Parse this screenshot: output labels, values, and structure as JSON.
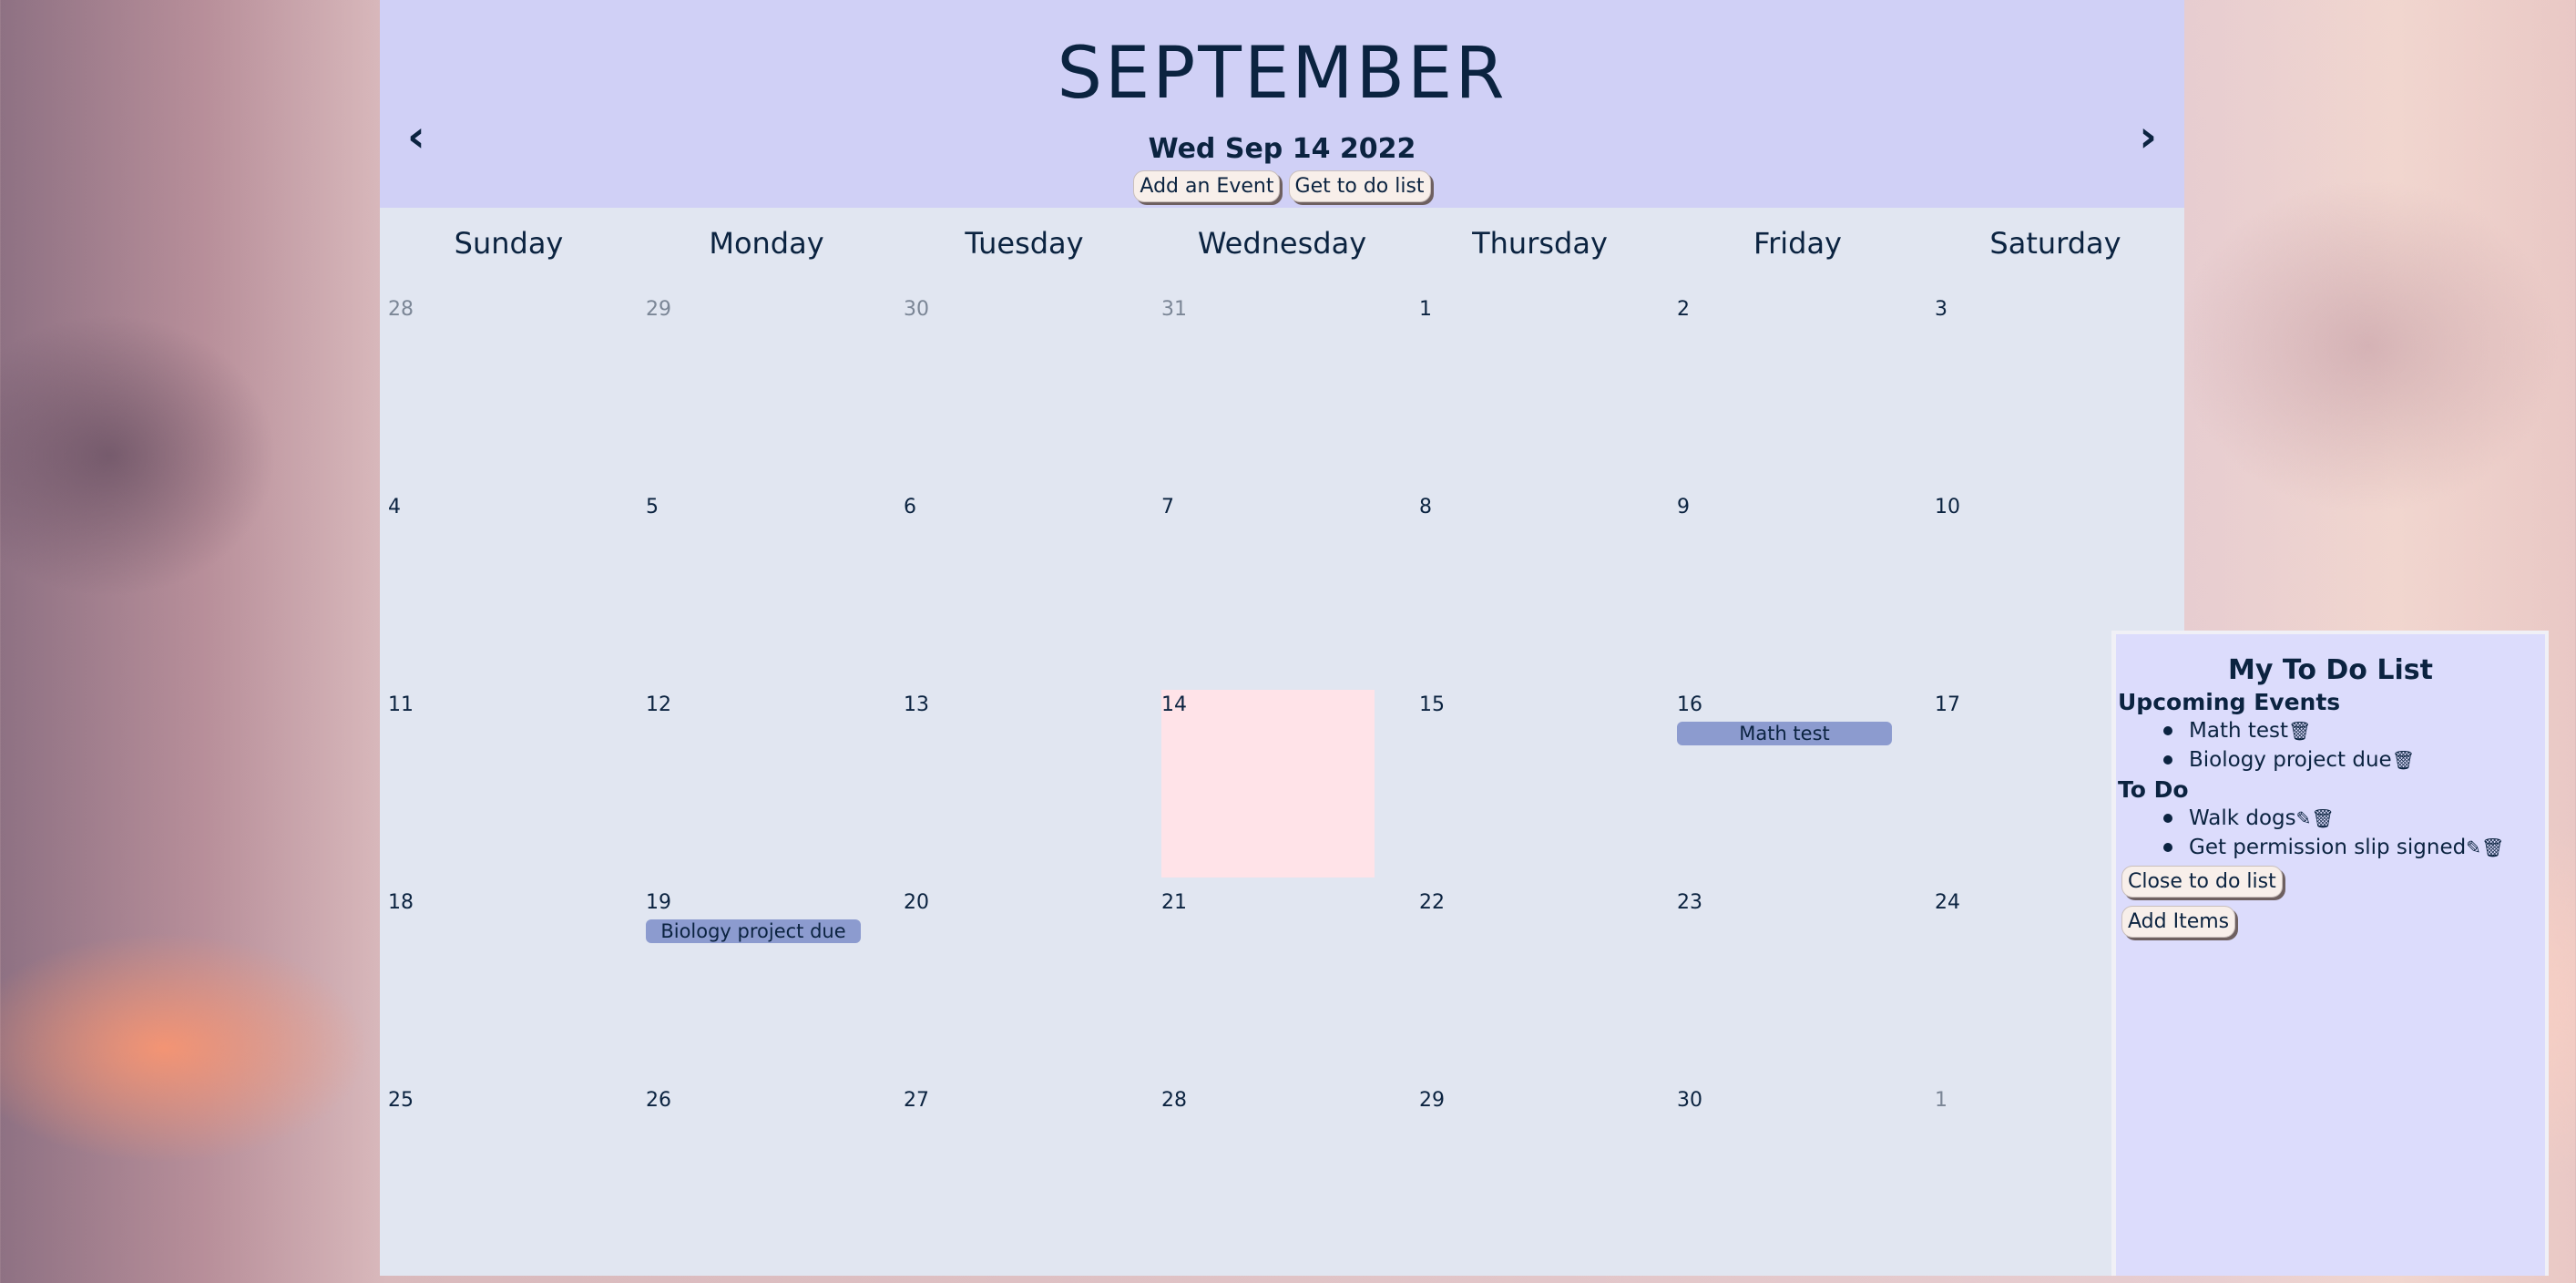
{
  "header": {
    "month": "SEPTEMBER",
    "date": "Wed Sep 14 2022",
    "prev_icon": "chevron-left-icon",
    "next_icon": "chevron-right-icon",
    "add_event_label": "Add an Event",
    "todo_label": "Get to do list"
  },
  "weekdays": [
    "Sunday",
    "Monday",
    "Tuesday",
    "Wednesday",
    "Thursday",
    "Friday",
    "Saturday"
  ],
  "weeks": [
    [
      {
        "d": "28",
        "other": true
      },
      {
        "d": "29",
        "other": true
      },
      {
        "d": "30",
        "other": true
      },
      {
        "d": "31",
        "other": true
      },
      {
        "d": "1"
      },
      {
        "d": "2"
      },
      {
        "d": "3"
      }
    ],
    [
      {
        "d": "4"
      },
      {
        "d": "5"
      },
      {
        "d": "6"
      },
      {
        "d": "7"
      },
      {
        "d": "8"
      },
      {
        "d": "9"
      },
      {
        "d": "10"
      }
    ],
    [
      {
        "d": "11"
      },
      {
        "d": "12"
      },
      {
        "d": "13"
      },
      {
        "d": "14",
        "today": true
      },
      {
        "d": "15"
      },
      {
        "d": "16",
        "event": "Math test"
      },
      {
        "d": "17"
      }
    ],
    [
      {
        "d": "18"
      },
      {
        "d": "19",
        "event": "Biology project due"
      },
      {
        "d": "20"
      },
      {
        "d": "21"
      },
      {
        "d": "22"
      },
      {
        "d": "23"
      },
      {
        "d": "24"
      }
    ],
    [
      {
        "d": "25"
      },
      {
        "d": "26"
      },
      {
        "d": "27"
      },
      {
        "d": "28"
      },
      {
        "d": "29"
      },
      {
        "d": "30"
      },
      {
        "d": "1",
        "other": true
      }
    ]
  ],
  "todo": {
    "title": "My To Do List",
    "upcoming_heading": "Upcoming Events",
    "upcoming": [
      "Math test",
      "Biology project due"
    ],
    "todo_heading": "To Do",
    "items": [
      "Walk dogs",
      "Get permission slip signed"
    ],
    "close_label": "Close to do list",
    "add_label": "Add Items",
    "edit_icon": "pencil-icon",
    "delete_icon": "trash-icon"
  },
  "colors": {
    "header_bg": "#d0d0f6",
    "calendar_bg": "#e1e6f1",
    "today_bg": "#ffe3e8",
    "event_bg": "#8c9bcf",
    "todo_bg": "#dcdcfc",
    "text": "#0b2340"
  }
}
